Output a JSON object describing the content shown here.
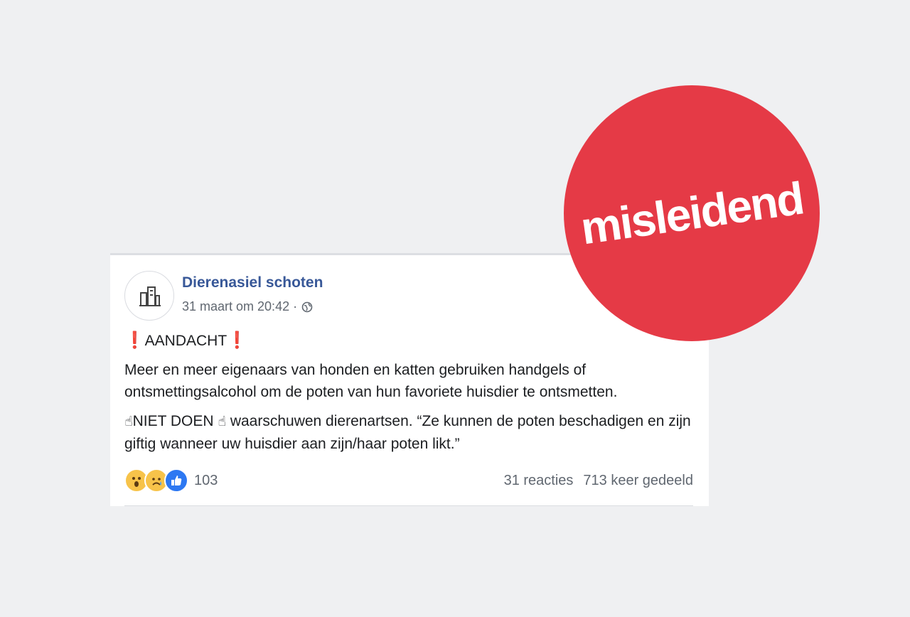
{
  "post": {
    "author": "Dierenasiel schoten",
    "timestamp": "31 maart om 20:42 ·",
    "privacy_icon": "globe-icon",
    "heading": "AANDACHT",
    "paragraph1": "Meer en meer eigenaars van honden en katten gebruiken handgels of ontsmettingsalcohol om de poten van hun favoriete huisdier te ontsmetten.",
    "niet_doen": "NIET DOEN",
    "paragraph2_rest": "waarschuwen dierenartsen. “Ze kunnen de poten beschadigen en zijn giftig wanneer uw huisdier aan zijn/haar poten likt.”",
    "reactions": [
      "wow",
      "sad",
      "like"
    ],
    "reaction_count": "103",
    "comments": "31 reacties",
    "shares": "713 keer gedeeld"
  },
  "stamp": {
    "label": "misleidend",
    "color": "#e53a46"
  },
  "colors": {
    "author": "#385898",
    "background": "#eff0f2"
  }
}
